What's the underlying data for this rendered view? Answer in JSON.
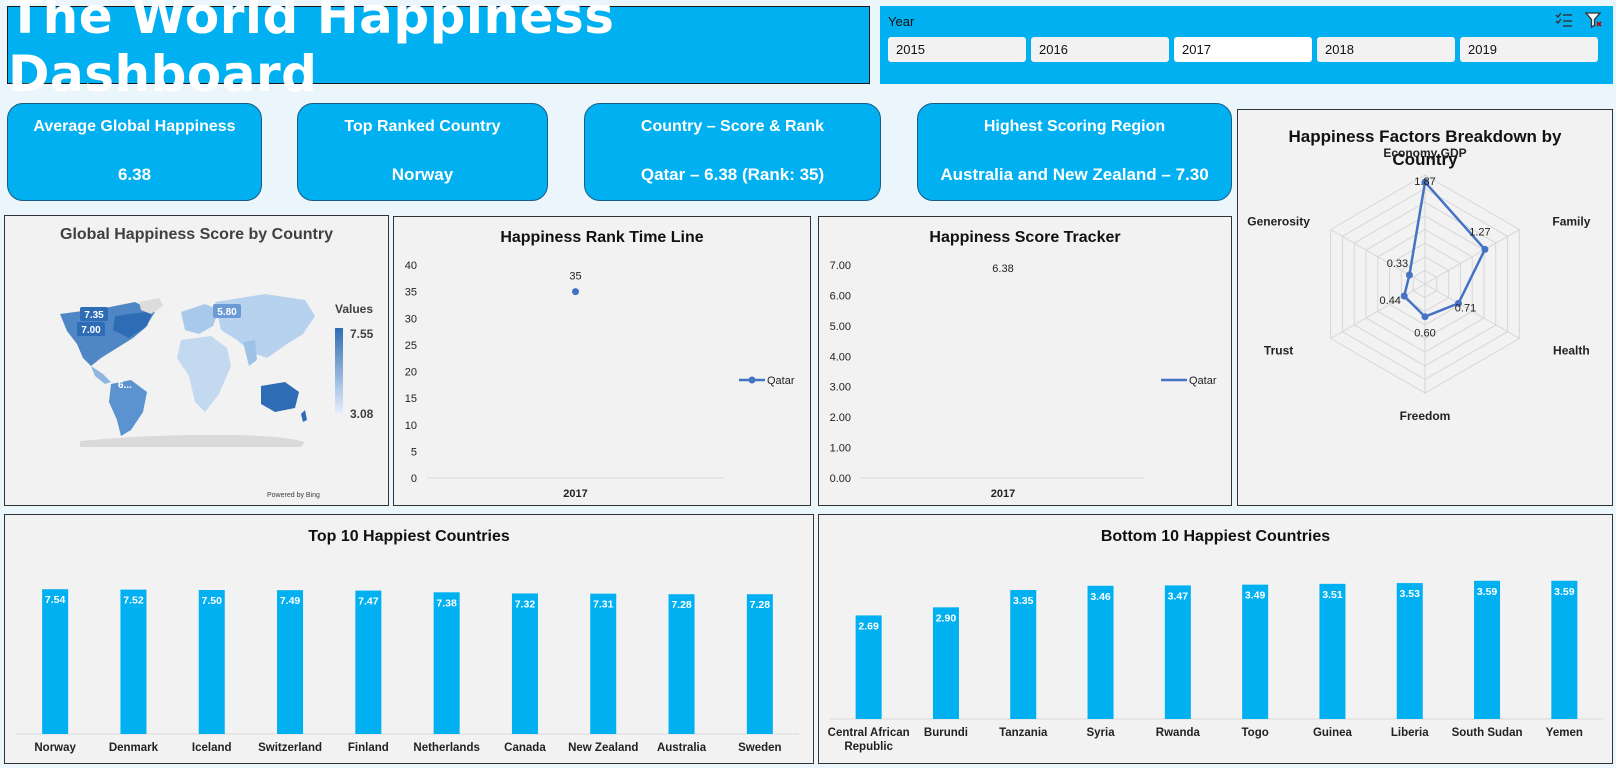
{
  "title": "The World Happiness Dashboard",
  "slicer": {
    "header": "Year",
    "years": [
      "2015",
      "2016",
      "2017",
      "2018",
      "2019"
    ],
    "selected": "2017"
  },
  "kpis": [
    {
      "label": "Average Global Happiness",
      "value": "6.38"
    },
    {
      "label": "Top Ranked Country",
      "value": "Norway"
    },
    {
      "label": "Country – Score & Rank",
      "value": "Qatar – 6.38 (Rank: 35)"
    },
    {
      "label": "Highest Scoring Region",
      "value": "Australia and New Zealand – 7.30"
    }
  ],
  "map": {
    "title": "Global Happiness Score by Country",
    "legend_title": "Values",
    "legend_max": "7.55",
    "legend_min": "3.08",
    "labels": [
      "7.35",
      "7.00",
      "5.80",
      "6..."
    ],
    "credit": "Powered by Bing"
  },
  "colors": {
    "accent": "#00b0f0",
    "line": "#4472c4",
    "panel": "#f2f2f2"
  },
  "chart_data": [
    {
      "type": "line",
      "title": "Happiness Rank Time Line",
      "categories": [
        "2017"
      ],
      "series": [
        {
          "name": "Qatar",
          "values": [
            35
          ]
        }
      ],
      "ylim": [
        0,
        40
      ],
      "yticks": [
        "0",
        "5",
        "10",
        "15",
        "20",
        "25",
        "30",
        "35",
        "40"
      ],
      "data_labels": [
        "35"
      ],
      "legend": "right"
    },
    {
      "type": "line",
      "title": "Happiness Score Tracker",
      "categories": [
        "2017"
      ],
      "series": [
        {
          "name": "Qatar",
          "values": [
            6.38
          ]
        }
      ],
      "ylim": [
        0,
        7
      ],
      "yticks": [
        "0.00",
        "1.00",
        "2.00",
        "3.00",
        "4.00",
        "5.00",
        "6.00",
        "7.00"
      ],
      "data_labels": [
        "6.38"
      ],
      "legend": "right"
    },
    {
      "type": "radar",
      "title": "Happiness Factors Breakdown by Country",
      "categories": [
        "Economy GDP",
        "Family",
        "Health",
        "Freedom",
        "Trust",
        "Generosity"
      ],
      "values": [
        1.87,
        1.27,
        0.71,
        0.6,
        0.44,
        0.33
      ],
      "data_labels": [
        "1.87",
        "1.27",
        "0.71",
        "0.60",
        "0.44",
        "0.33"
      ],
      "rmax": 2
    },
    {
      "type": "bar",
      "title": "Top 10 Happiest Countries",
      "categories": [
        "Norway",
        "Denmark",
        "Iceland",
        "Switzerland",
        "Finland",
        "Netherlands",
        "Canada",
        "New Zealand",
        "Australia",
        "Sweden"
      ],
      "values": [
        7.54,
        7.52,
        7.5,
        7.49,
        7.47,
        7.38,
        7.32,
        7.31,
        7.28,
        7.28
      ],
      "data_labels": [
        "7.54",
        "7.52",
        "7.50",
        "7.49",
        "7.47",
        "7.38",
        "7.32",
        "7.31",
        "7.28",
        "7.28"
      ]
    },
    {
      "type": "bar",
      "title": "Bottom 10 Happiest Countries",
      "categories": [
        "Central African Republic",
        "Burundi",
        "Tanzania",
        "Syria",
        "Rwanda",
        "Togo",
        "Guinea",
        "Liberia",
        "South Sudan",
        "Yemen"
      ],
      "values": [
        2.69,
        2.9,
        3.35,
        3.46,
        3.47,
        3.49,
        3.51,
        3.53,
        3.59,
        3.59
      ],
      "data_labels": [
        "2.69",
        "2.90",
        "3.35",
        "3.46",
        "3.47",
        "3.49",
        "3.51",
        "3.53",
        "3.59",
        "3.59"
      ]
    }
  ]
}
